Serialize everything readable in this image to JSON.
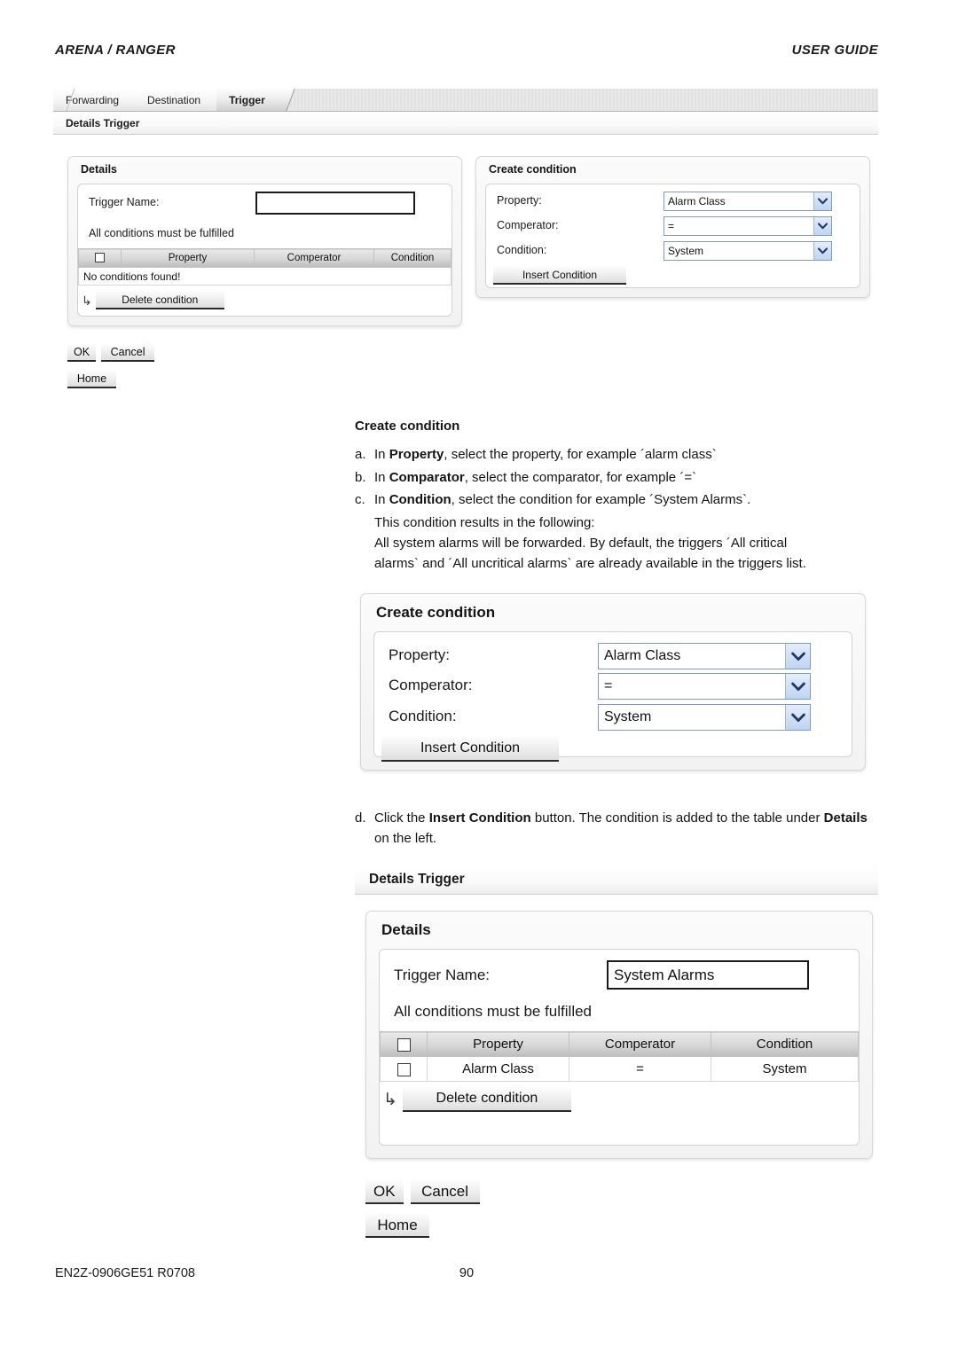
{
  "header": {
    "left": "ARENA / RANGER",
    "right": "USER GUIDE"
  },
  "footer": {
    "doc_id": "EN2Z-0906GE51 R0708",
    "page_number": "90"
  },
  "screenshot_top": {
    "tabs": [
      {
        "label": "Forwarding",
        "active": false
      },
      {
        "label": "Destination",
        "active": false
      },
      {
        "label": "Trigger",
        "active": true
      }
    ],
    "module_title": "Details Trigger",
    "details_panel": {
      "title": "Details",
      "trigger_name_label": "Trigger Name:",
      "trigger_name_value": "",
      "conditions_note": "All conditions must be fulfilled",
      "table": {
        "columns": [
          "",
          "Property",
          "Comperator",
          "Condition"
        ],
        "empty_message": "No conditions found!",
        "rows": []
      },
      "delete_button": "Delete condition",
      "branch_arrow_icon": "↳"
    },
    "create_panel": {
      "title": "Create condition",
      "fields": [
        {
          "label": "Property:",
          "value": "Alarm Class"
        },
        {
          "label": "Comperator:",
          "value": "="
        },
        {
          "label": "Condition:",
          "value": "System"
        }
      ],
      "insert_button": "Insert Condition"
    },
    "actions": {
      "ok": "OK",
      "cancel": "Cancel",
      "home": "Home"
    }
  },
  "body_text": {
    "heading": "Create condition",
    "steps": [
      {
        "marker": "a.",
        "parts": [
          {
            "text": "In ",
            "bold": false
          },
          {
            "text": "Property",
            "bold": true
          },
          {
            "text": ", select the property, for example ´alarm class`",
            "bold": false
          }
        ]
      },
      {
        "marker": "b.",
        "parts": [
          {
            "text": "In ",
            "bold": false
          },
          {
            "text": "Comparator",
            "bold": true
          },
          {
            "text": ", select the comparator, for example ´=`",
            "bold": false
          }
        ]
      },
      {
        "marker": "c.",
        "parts": [
          {
            "text": "In ",
            "bold": false
          },
          {
            "text": "Condition",
            "bold": true
          },
          {
            "text": ", select the condition for example ´System Alarms`.",
            "bold": false
          }
        ]
      }
    ],
    "continuation_lines": [
      "This condition results in the following:",
      "All system alarms will be forwarded. By default, the triggers ´All critical",
      "alarms` and ´All uncritical alarms` are already available in the triggers list."
    ],
    "step_d": {
      "marker": "d.",
      "parts": [
        {
          "text": "Click the ",
          "bold": false
        },
        {
          "text": "Insert Condition",
          "bold": true
        },
        {
          "text": " button. The condition is added to the table under ",
          "bold": false
        },
        {
          "text": "Details",
          "bold": true
        },
        {
          "text": " on the left.",
          "bold": false
        }
      ]
    }
  },
  "screenshot_create_condition": {
    "title": "Create condition",
    "fields": [
      {
        "label": "Property:",
        "value": "Alarm Class"
      },
      {
        "label": "Comperator:",
        "value": "="
      },
      {
        "label": "Condition:",
        "value": "System"
      }
    ],
    "insert_button": "Insert Condition"
  },
  "screenshot_details_trigger": {
    "module_title": "Details Trigger",
    "panel_title": "Details",
    "trigger_name_label": "Trigger Name:",
    "trigger_name_value": "System Alarms",
    "conditions_note": "All conditions must be fulfilled",
    "table": {
      "columns": [
        "",
        "Property",
        "Comperator",
        "Condition"
      ],
      "rows": [
        {
          "property": "Alarm Class",
          "comperator": "=",
          "condition": "System"
        }
      ]
    },
    "delete_button": "Delete condition",
    "branch_arrow_icon": "↳",
    "actions": {
      "ok": "OK",
      "cancel": "Cancel",
      "home": "Home"
    }
  },
  "colors": {
    "select_border": "#7f9bc4",
    "select_button": "#bfd4f2",
    "tab_active_bg": "#e0e0e0",
    "grid_header_bg": "#d6d6d6",
    "text": "#111111"
  }
}
